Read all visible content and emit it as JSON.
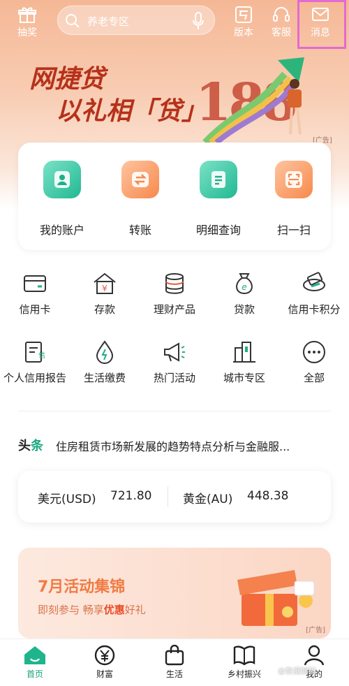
{
  "topbar": {
    "lottery_label": "抽奖",
    "search_placeholder": "养老专区",
    "version_label": "版本",
    "service_label": "客服",
    "message_label": "消息"
  },
  "banner": {
    "line1": "网捷贷",
    "line2": "以礼相「贷」",
    "big_number": "188",
    "ad_tag": "[广告]"
  },
  "quick_actions": [
    {
      "label": "我的账户",
      "icon": "user-icon"
    },
    {
      "label": "转账",
      "icon": "transfer-icon"
    },
    {
      "label": "明细查询",
      "icon": "document-icon"
    },
    {
      "label": "扫一扫",
      "icon": "scan-icon"
    }
  ],
  "grid": [
    {
      "label": "信用卡",
      "icon": "credit-card-icon"
    },
    {
      "label": "存款",
      "icon": "deposit-icon"
    },
    {
      "label": "理财产品",
      "icon": "coins-icon"
    },
    {
      "label": "贷款",
      "icon": "loan-bag-icon"
    },
    {
      "label": "信用卡积分",
      "icon": "points-icon"
    },
    {
      "label": "个人信用报告",
      "icon": "credit-report-icon"
    },
    {
      "label": "生活缴费",
      "icon": "water-drop-icon"
    },
    {
      "label": "热门活动",
      "icon": "megaphone-icon"
    },
    {
      "label": "城市专区",
      "icon": "city-icon"
    },
    {
      "label": "全部",
      "icon": "more-icon"
    }
  ],
  "headline": {
    "tag_a": "头",
    "tag_b": "条",
    "text": "住房租赁市场新发展的趋势特点分析与金融服..."
  },
  "rates": {
    "usd_label": "美元(USD)",
    "usd_value": "721.80",
    "gold_label": "黄金(AU)",
    "gold_value": "448.38"
  },
  "activity": {
    "title": "7月活动集锦",
    "sub_a": "即刻参与  畅享",
    "sub_b": "优惠",
    "sub_c": "好礼",
    "ad_tag": "[广告]"
  },
  "nav": [
    {
      "label": "首页",
      "icon": "home-icon",
      "active": true
    },
    {
      "label": "财富",
      "icon": "yuan-icon",
      "active": false
    },
    {
      "label": "生活",
      "icon": "shopping-bag-icon",
      "active": false
    },
    {
      "label": "乡村振兴",
      "icon": "book-icon",
      "active": false
    },
    {
      "label": "我的",
      "icon": "profile-icon",
      "active": false
    }
  ],
  "watermark": "@数据解码",
  "colors": {
    "accent": "#19a27a",
    "orange": "#f7894d",
    "banner_red": "#b6311b"
  }
}
